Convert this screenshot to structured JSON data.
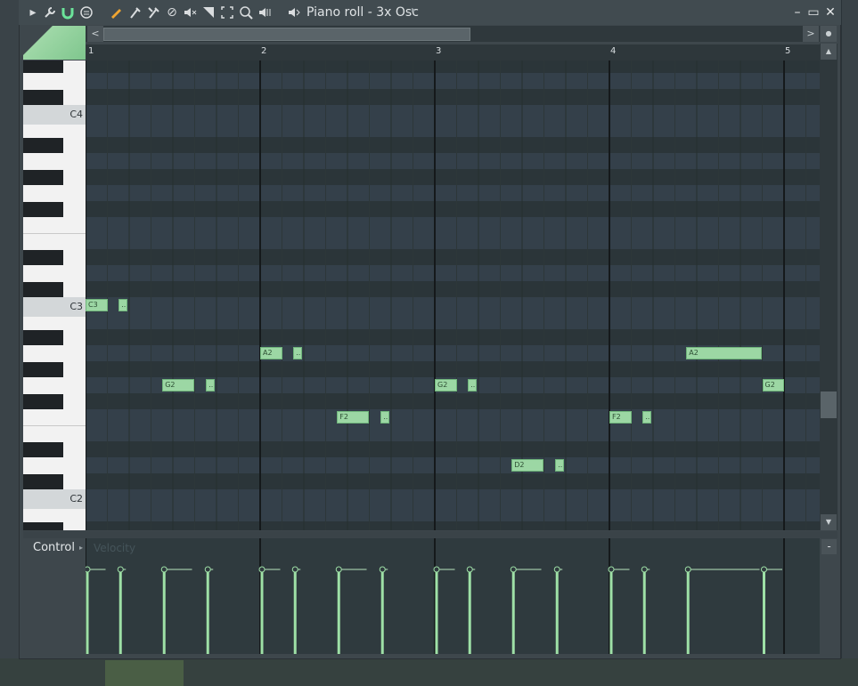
{
  "window": {
    "title": "Piano roll - 3x Osc",
    "title_arrow": "▸",
    "controls": {
      "minimize": "–",
      "maximize": "▭",
      "close": "✕"
    }
  },
  "toolbar": {
    "icons": [
      "menu-arrow-icon",
      "wrench-icon",
      "magnet-icon",
      "stamp-icon",
      "pencil-icon",
      "paint-brush-icon",
      "delete-icon",
      "mute-icon",
      "slice-icon",
      "select-icon",
      "zoom-icon",
      "playback-icon",
      "speaker-icon"
    ]
  },
  "scroll": {
    "left_arrow": "<",
    "right_arrow": ">",
    "up_arrow": "▲",
    "down_arrow": "▼"
  },
  "ruler": {
    "bars": [
      "1",
      "2",
      "3",
      "4",
      "5"
    ]
  },
  "keyboard": {
    "octaves": [
      "C4",
      "C3",
      "C2"
    ]
  },
  "notes": [
    {
      "label": "C3",
      "bar": 1.0,
      "length": 0.125,
      "pitch": "C3"
    },
    {
      "label": "..",
      "bar": 1.19,
      "length": 0.05,
      "pitch": "C3"
    },
    {
      "label": "G2",
      "bar": 1.44,
      "length": 0.18,
      "pitch": "G2"
    },
    {
      "label": "..",
      "bar": 1.69,
      "length": 0.05,
      "pitch": "G2"
    },
    {
      "label": "A2",
      "bar": 2.0,
      "length": 0.125,
      "pitch": "A2"
    },
    {
      "label": "..",
      "bar": 2.19,
      "length": 0.05,
      "pitch": "A2"
    },
    {
      "label": "F2",
      "bar": 2.44,
      "length": 0.18,
      "pitch": "F2"
    },
    {
      "label": "..",
      "bar": 2.69,
      "length": 0.05,
      "pitch": "F2"
    },
    {
      "label": "G2",
      "bar": 3.0,
      "length": 0.125,
      "pitch": "G2"
    },
    {
      "label": "..",
      "bar": 3.19,
      "length": 0.05,
      "pitch": "G2"
    },
    {
      "label": "D2",
      "bar": 3.44,
      "length": 0.18,
      "pitch": "D2"
    },
    {
      "label": "..",
      "bar": 3.69,
      "length": 0.05,
      "pitch": "D2"
    },
    {
      "label": "F2",
      "bar": 4.0,
      "length": 0.125,
      "pitch": "F2"
    },
    {
      "label": "..",
      "bar": 4.19,
      "length": 0.05,
      "pitch": "F2"
    },
    {
      "label": "A2",
      "bar": 4.44,
      "length": 0.43,
      "pitch": "A2"
    },
    {
      "label": "G2",
      "bar": 4.875,
      "length": 0.125,
      "pitch": "G2"
    }
  ],
  "control": {
    "label": "Control",
    "arrow": "▸",
    "parameter": "Velocity",
    "minus": "-"
  },
  "colors": {
    "note_fill": "#9cd7a4",
    "note_border": "#6fb57b",
    "grid_bg": "#2f3a3e",
    "velocity_line": "#9ee0a6"
  }
}
